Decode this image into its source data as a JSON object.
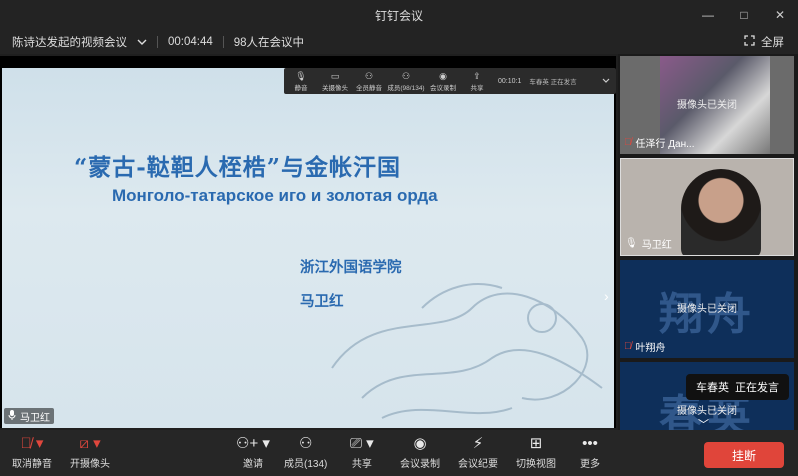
{
  "window": {
    "title": "钉钉会议",
    "controls": [
      "—",
      "□",
      "✕"
    ]
  },
  "infobar": {
    "meeting_name": "陈诗达发起的视频会议",
    "duration": "00:04:44",
    "participants": "98人在会议中",
    "fullscreen_label": "全屏"
  },
  "share_toolbar": {
    "items": [
      {
        "icon": "mic-icon",
        "label": "静音"
      },
      {
        "icon": "camera-icon",
        "label": "关摄像头"
      },
      {
        "icon": "mute-all-icon",
        "label": "全员静音"
      },
      {
        "icon": "members-icon",
        "label": "成员(98/134)"
      },
      {
        "icon": "record-icon",
        "label": "会议录制"
      },
      {
        "icon": "share-icon",
        "label": "共享"
      }
    ],
    "timer": "00:10:1",
    "speaker": "车春英 正在发言"
  },
  "slide": {
    "title_cn": "“蒙古-鞑靼人桎梏”与金帐汗国",
    "title_ru": "Монголо-татарское иго и золотая орда",
    "institution": "浙江外国语学院",
    "author": "马卫红"
  },
  "share_label": "马卫红",
  "participants": [
    {
      "name": "任泽行  Дан...",
      "status": "摄像头已关闭"
    },
    {
      "name": "马卫红",
      "status": ""
    },
    {
      "name": "叶翔舟",
      "status": "摄像头已关闭",
      "avatar_text": "翔舟"
    },
    {
      "name": "",
      "status": "摄像头已关闭",
      "avatar_text": "春英"
    }
  ],
  "speaking_toast": {
    "name": "车春英",
    "text": "正在发言"
  },
  "bottom_toolbar": {
    "items": [
      {
        "icon": "mic-off-icon",
        "label": "取消静音"
      },
      {
        "icon": "camera-off-icon",
        "label": "开摄像头"
      },
      {
        "icon": "invite-icon",
        "label": "邀请"
      },
      {
        "icon": "members-icon",
        "label": "成员(134)"
      },
      {
        "icon": "share-screen-icon",
        "label": "共享"
      },
      {
        "icon": "record-icon",
        "label": "会议录制"
      },
      {
        "icon": "minutes-icon",
        "label": "会议纪要"
      },
      {
        "icon": "grid-view-icon",
        "label": "切换视图"
      },
      {
        "icon": "more-icon",
        "label": "更多"
      }
    ],
    "hangup_label": "挂断"
  },
  "colors": {
    "accent": "#2a6ab0",
    "hangup": "#e0453a",
    "tile_bg": "#0e2f5a"
  }
}
